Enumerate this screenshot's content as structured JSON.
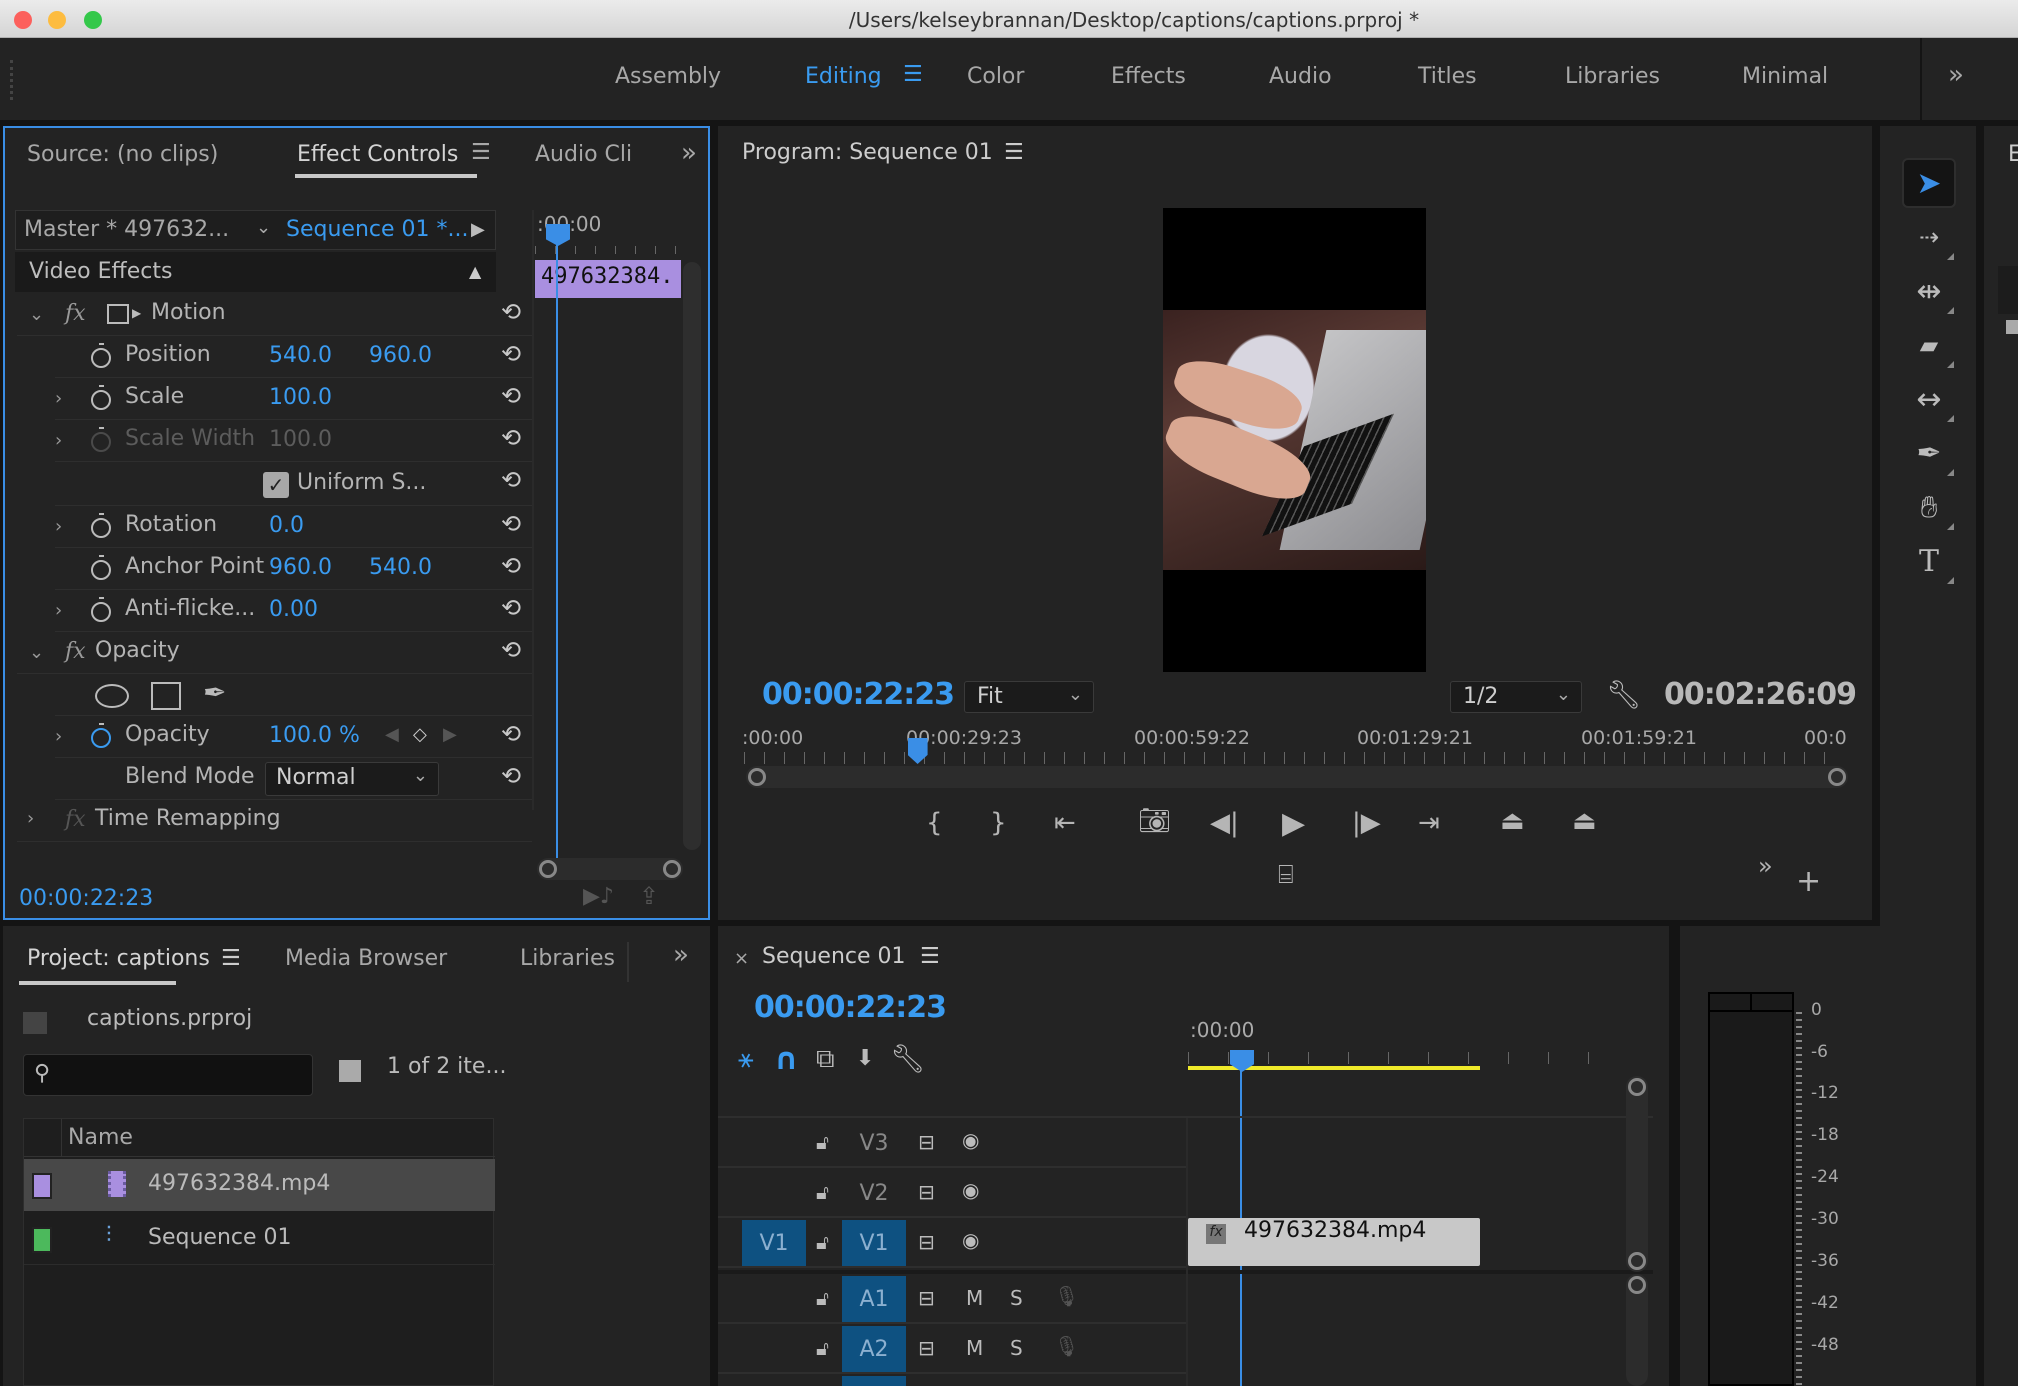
{
  "window": {
    "title": "/Users/kelseybrannan/Desktop/captions/captions.prproj *",
    "traffic_lights": [
      "#fc605c",
      "#fdbc40",
      "#34c84a"
    ]
  },
  "workspaces": {
    "tabs": [
      "Assembly",
      "Editing",
      "Color",
      "Effects",
      "Audio",
      "Titles",
      "Libraries",
      "Minimal"
    ],
    "active": "Editing",
    "overflow": "»"
  },
  "effect_controls": {
    "tabs": [
      "Source: (no clips)",
      "Effect Controls",
      "Audio Cli"
    ],
    "active_tab": "Effect Controls",
    "master_label": "Master * 497632...",
    "sequence_label": "Sequence 01 *...",
    "section": "Video Effects",
    "mini_timeline": {
      "ruler": ":00:00",
      "clip": "497632384."
    },
    "motion": {
      "label": "Motion",
      "properties": [
        {
          "name": "Position",
          "v1": "540.0",
          "v2": "960.0"
        },
        {
          "name": "Scale",
          "v1": "100.0"
        },
        {
          "name": "Scale Width",
          "v1": "100.0",
          "disabled": true
        },
        {
          "name": "Uniform S...",
          "checkbox": true
        },
        {
          "name": "Rotation",
          "v1": "0.0"
        },
        {
          "name": "Anchor Point",
          "v1": "960.0",
          "v2": "540.0"
        },
        {
          "name": "Anti-flicke...",
          "v1": "0.00"
        }
      ]
    },
    "opacity": {
      "label": "Opacity",
      "value": "100.0 %",
      "prop_label": "Opacity",
      "blend_label": "Blend Mode",
      "blend_value": "Normal"
    },
    "time_remapping": "Time Remapping",
    "timecode": "00:00:22:23"
  },
  "program_monitor": {
    "title": "Program: Sequence 01",
    "timecode": "00:00:22:23",
    "zoom": "Fit",
    "resolution": "1/2",
    "duration": "00:02:26:09",
    "ruler": [
      ":00:00",
      "00:00:29:23",
      "00:00:59:22",
      "00:01:29:21",
      "00:01:59:21",
      "00:0"
    ],
    "playhead_fraction": 0.156
  },
  "project": {
    "tabs": [
      "Project: captions",
      "Media Browser",
      "Libraries"
    ],
    "file": "captions.prproj",
    "search_placeholder": "",
    "count": "1 of 2 ite...",
    "column": "Name",
    "items": [
      {
        "name": "497632384.mp4",
        "color": "#a98fe0",
        "type": "clip"
      },
      {
        "name": "Sequence 01",
        "color": "#4cb95c",
        "type": "sequence"
      }
    ]
  },
  "timeline": {
    "title": "Sequence 01",
    "timecode": "00:00:22:23",
    "ruler": ":00:00",
    "video_tracks": [
      "V3",
      "V2",
      "V1"
    ],
    "audio_tracks": [
      "A1",
      "A2"
    ],
    "source_patch": "V1",
    "clip": "497632384.mp4",
    "mute": "M",
    "solo": "S"
  },
  "audio_meter": {
    "scale": [
      "0",
      "-6",
      "-12",
      "-18",
      "-24",
      "-30",
      "-36",
      "-42",
      "-48"
    ]
  },
  "tools": [
    "selection",
    "track-select-forward",
    "ripple-edit",
    "razor",
    "slip",
    "pen",
    "hand",
    "type"
  ]
}
